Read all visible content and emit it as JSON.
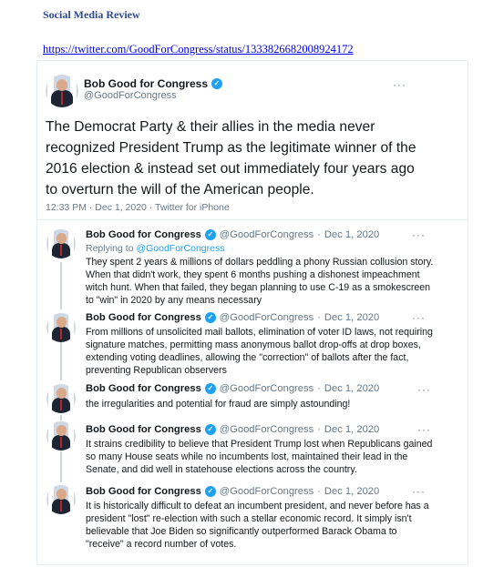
{
  "review_title": "Social Media Review",
  "source_url": "https://twitter.com/GoodForCongress/status/1333826682008924172",
  "main_tweet": {
    "display_name": "Bob Good for Congress",
    "handle": "@GoodForCongress",
    "more": "···",
    "text": "The Democrat Party & their allies in the media never recognized President Trump as the legitimate winner of the 2016 election & instead set out immediately four years ago to overturn the will of the American people.",
    "meta": "12:33 PM · Dec 1, 2020 · Twitter for iPhone"
  },
  "replies": [
    {
      "display_name": "Bob Good for Congress",
      "handle": "@GoodForCongress",
      "separator": "·",
      "date": "Dec 1, 2020",
      "more": "···",
      "replying_label": "Replying to",
      "replying_to": "@GoodForCongress",
      "text": "They spent 2 years & millions of dollars peddling a phony Russian collusion story. When that didn't work, they spent 6 months pushing a dishonest impeachment witch hunt. When that failed, they began planning to use C-19 as a smokescreen to \"win\" in 2020 by any means necessary"
    },
    {
      "display_name": "Bob Good for Congress",
      "handle": "@GoodForCongress",
      "separator": "·",
      "date": "Dec 1, 2020",
      "more": "···",
      "text": "From millions of unsolicited mail ballots, elimination of voter ID laws, not requiring signature matches, permitting mass anonymous ballot drop-offs at drop boxes, extending voting deadlines, allowing the \"correction\" of ballots after the fact, preventing Republican observers"
    },
    {
      "display_name": "Bob Good for Congress",
      "handle": "@GoodForCongress",
      "separator": "·",
      "date": "Dec 1, 2020",
      "more": "···",
      "text": "the irregularities and potential for fraud are simply astounding!"
    },
    {
      "display_name": "Bob Good for Congress",
      "handle": "@GoodForCongress",
      "separator": "·",
      "date": "Dec 1, 2020",
      "more": "···",
      "text": "It strains credibility to believe that President Trump lost when Republicans gained so many House seats while no incumbents lost, maintained their lead in the Senate, and did well in statehouse elections across the country."
    },
    {
      "display_name": "Bob Good for Congress",
      "handle": "@GoodForCongress",
      "separator": "·",
      "date": "Dec 1, 2020",
      "more": "···",
      "text": "It is historically difficult to defeat an incumbent president, and never before has a president \"lost\" re-election with such a stellar economic record.  It simply isn't believable that Joe Biden so significantly outperformed Barack Obama to \"receive\" a record number of votes."
    }
  ],
  "verified_glyph": "✓",
  "colors": {
    "link_blue": "#1da1f2",
    "muted_gray": "#657786",
    "title_blue": "#2f4a8c"
  }
}
